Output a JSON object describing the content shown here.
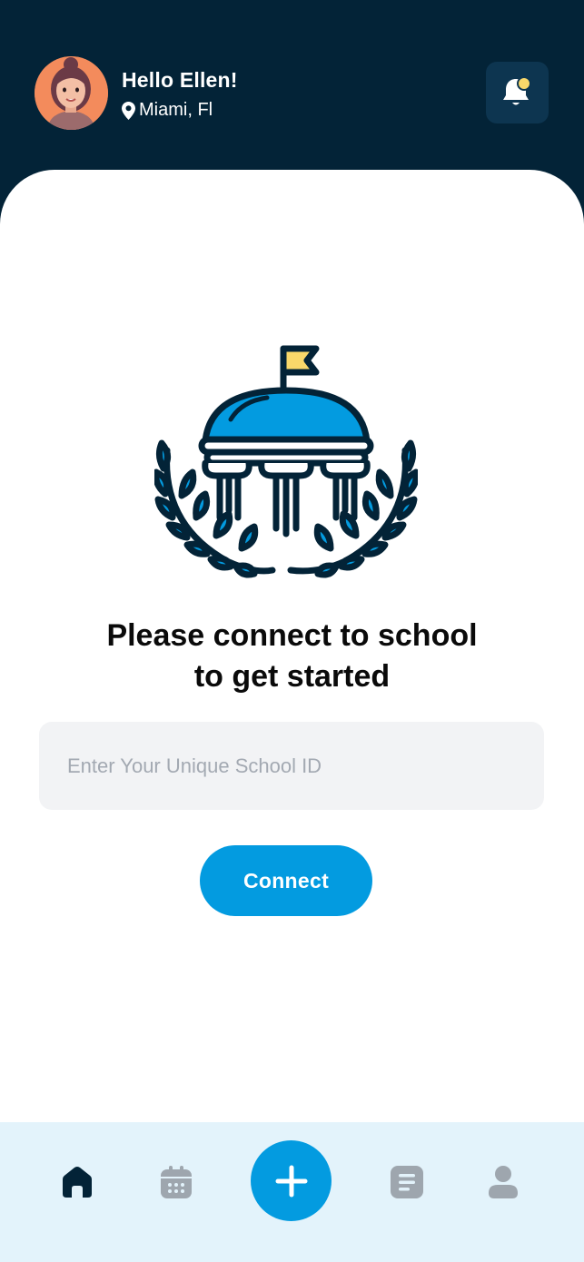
{
  "header": {
    "greeting": "Hello Ellen!",
    "location": "Miami, Fl",
    "avatar_icon": "user-avatar",
    "notification_icon": "bell-icon"
  },
  "main": {
    "emblem_icon": "school-building-icon",
    "headline_line1": "Please connect to school",
    "headline_line2": "to get started",
    "school_id_placeholder": "Enter Your Unique School ID",
    "school_id_value": "",
    "connect_label": "Connect"
  },
  "tabbar": {
    "items": [
      {
        "icon": "home-icon",
        "active": true
      },
      {
        "icon": "calendar-icon",
        "active": false
      },
      {
        "icon": "plus-icon",
        "active": false
      },
      {
        "icon": "notes-icon",
        "active": false
      },
      {
        "icon": "profile-icon",
        "active": false
      }
    ]
  },
  "colors": {
    "header_bg": "#032337",
    "accent": "#039BE0",
    "tabbar_bg": "#E3F3FB",
    "inactive_icon": "#9EA6AE",
    "active_icon": "#032337",
    "notification_dot": "#F9D86A"
  }
}
